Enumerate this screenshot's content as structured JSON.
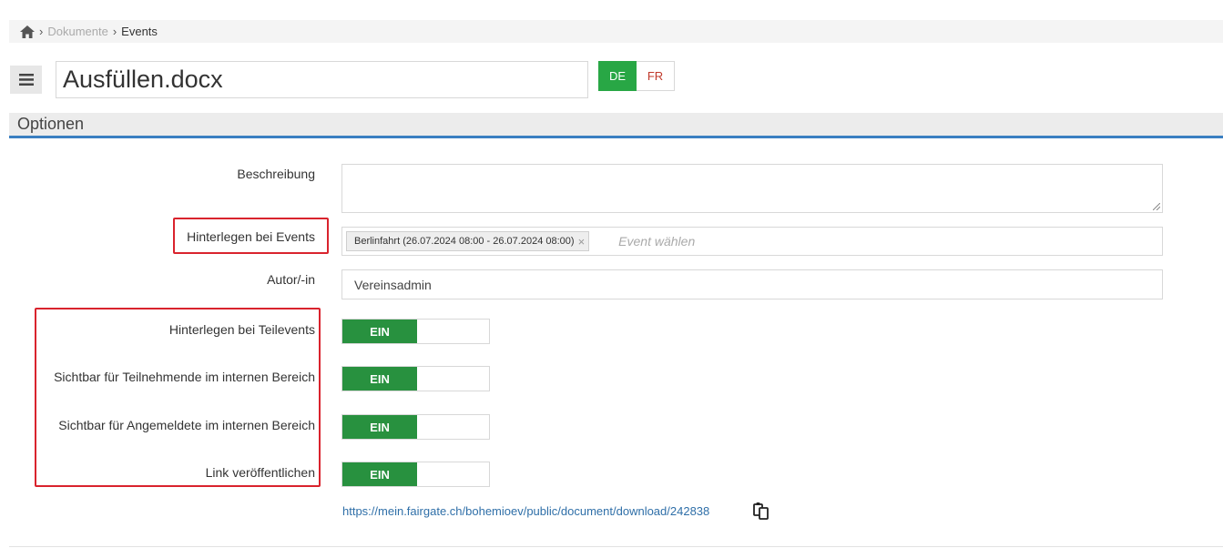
{
  "breadcrumb": {
    "home_icon": "home-icon",
    "items": [
      "Dokumente",
      "Events"
    ]
  },
  "header": {
    "menu_icon": "hamburger-icon",
    "title_value": "Ausfüllen.docx",
    "languages": [
      "DE",
      "FR"
    ],
    "active_language": "DE"
  },
  "section": {
    "title": "Optionen"
  },
  "form": {
    "description_label": "Beschreibung",
    "description_value": "",
    "events_label": "Hinterlegen bei Events",
    "event_tag": "Berlinfahrt (26.07.2024 08:00 - 26.07.2024 08:00)",
    "event_tag_remove": "×",
    "events_placeholder": "Event wählen",
    "author_label": "Autor/-in",
    "author_value": "Vereinsadmin",
    "toggles": [
      {
        "label": "Hinterlegen bei Teilevents",
        "state": "EIN"
      },
      {
        "label": "Sichtbar für Teilnehmende im internen Bereich",
        "state": "EIN"
      },
      {
        "label": "Sichtbar für Angemeldete im internen Bereich",
        "state": "EIN"
      },
      {
        "label": "Link veröffentlichen",
        "state": "EIN"
      }
    ],
    "public_link": "https://mein.fairgate.ch/bohemioev/public/document/download/242838",
    "copy_icon": "copy-icon"
  },
  "colors": {
    "toggle_on": "#28913f",
    "lang_active": "#28a745",
    "section_underline": "#3a7fc1",
    "highlight_box": "#d9232d",
    "link": "#2f6fa8"
  }
}
